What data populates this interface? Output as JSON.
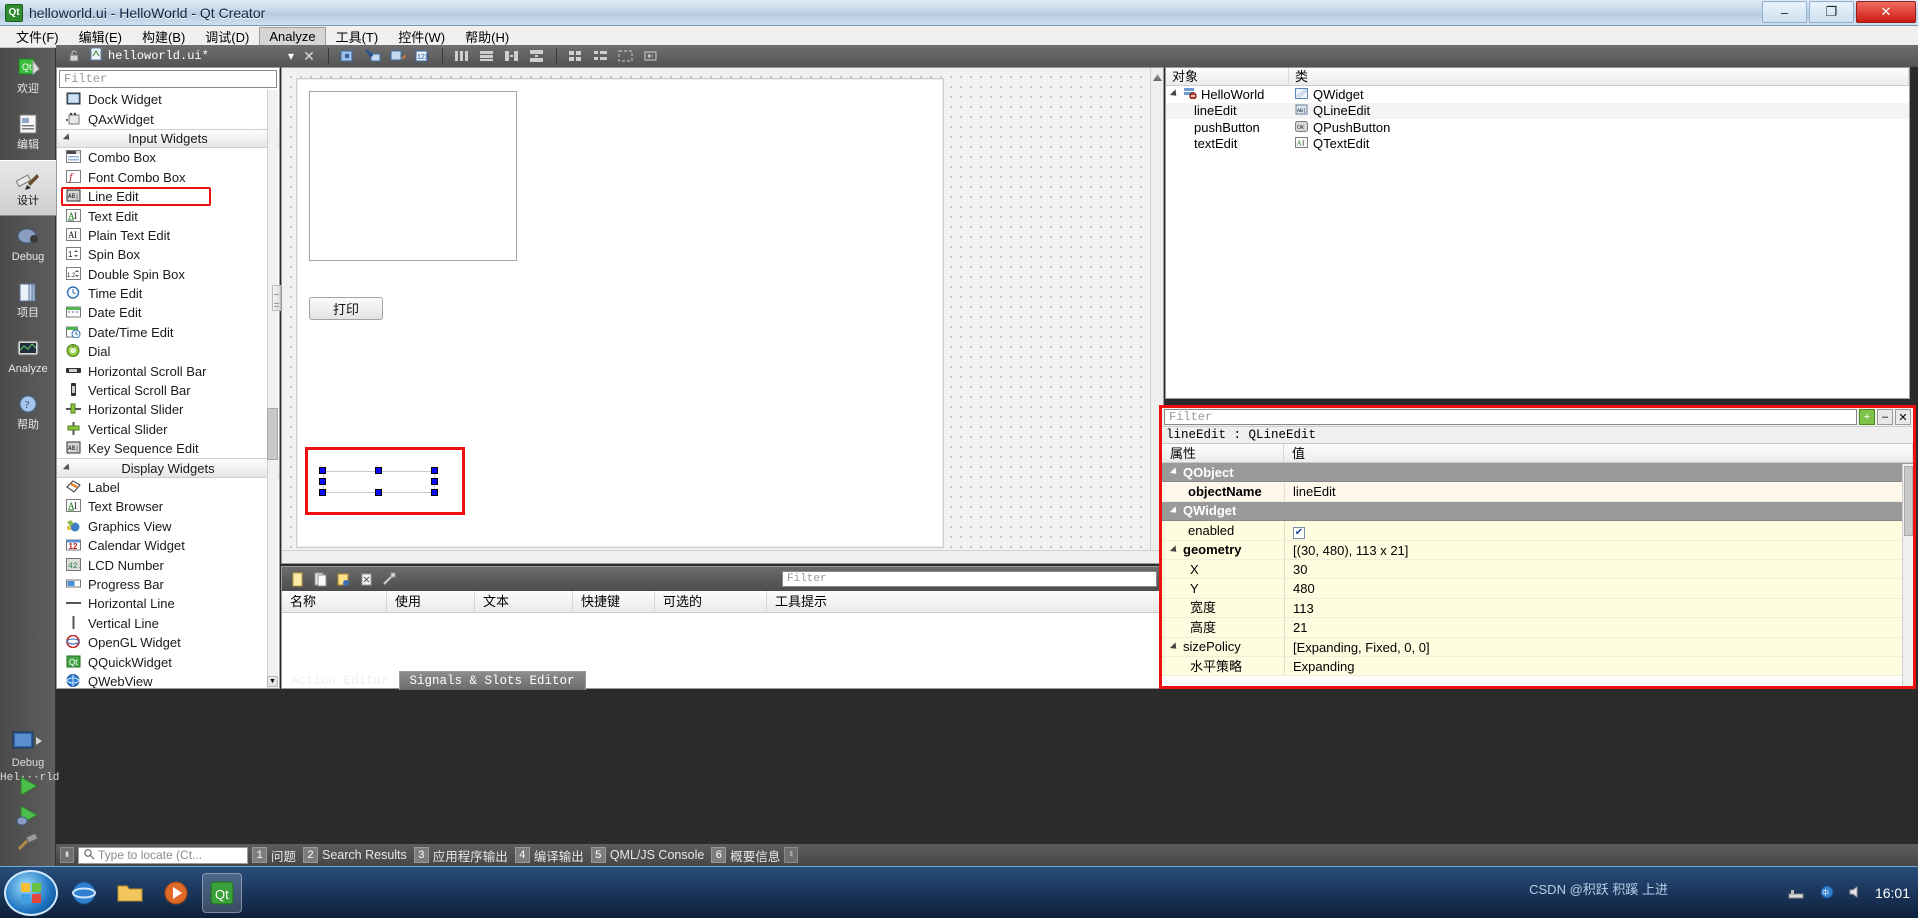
{
  "window": {
    "title": "helloworld.ui - HelloWorld - Qt Creator",
    "app_icon": "qt-logo-icon",
    "minimize": "–",
    "maximize": "❐",
    "close": "✕"
  },
  "menubar": {
    "items": [
      {
        "label": "文件(F)",
        "active": false
      },
      {
        "label": "编辑(E)",
        "active": false
      },
      {
        "label": "构建(B)",
        "active": false
      },
      {
        "label": "调试(D)",
        "active": false
      },
      {
        "label": "Analyze",
        "active": true
      },
      {
        "label": "工具(T)",
        "active": false
      },
      {
        "label": "控件(W)",
        "active": false
      },
      {
        "label": "帮助(H)",
        "active": false
      }
    ]
  },
  "modebar": {
    "items": [
      {
        "label": "欢迎",
        "icon": "qt-welcome-icon",
        "selected": false
      },
      {
        "label": "编辑",
        "icon": "edit-document-icon",
        "selected": false
      },
      {
        "label": "设计",
        "icon": "design-brush-icon",
        "selected": true
      },
      {
        "label": "Debug",
        "icon": "debug-bug-icon",
        "selected": false
      },
      {
        "label": "项目",
        "icon": "projects-folder-icon",
        "selected": false
      },
      {
        "label": "Analyze",
        "icon": "analyze-scope-icon",
        "selected": false
      },
      {
        "label": "帮助",
        "icon": "help-question-icon",
        "selected": false
      }
    ],
    "kit_label": "Hel···rld",
    "debug_label": "Debug",
    "run_icon": "run-play-icon",
    "debug_run_icon": "debug-play-icon",
    "build_icon": "build-hammer-icon"
  },
  "editor_toolbar": {
    "lock_icon": "unlocked-icon",
    "file_icon": "ui-file-icon",
    "file_name": "helloworld.ui*",
    "dropdown_icon": "chevron-down-icon",
    "close_icon": "close-icon",
    "tools": [
      {
        "icon": "edit-widgets-icon",
        "name": "edit-widgets-tool"
      },
      {
        "icon": "edit-signals-slots-icon",
        "name": "edit-signals-slots-tool"
      },
      {
        "icon": "edit-buddies-icon",
        "name": "edit-buddies-tool"
      },
      {
        "icon": "edit-tab-order-icon",
        "name": "edit-tab-order-tool"
      },
      {
        "icon": "layout-horizontal-icon",
        "name": "layout-horizontally-tool"
      },
      {
        "icon": "layout-vertical-icon",
        "name": "layout-vertically-tool"
      },
      {
        "icon": "layout-splitter-h-icon",
        "name": "layout-split-horizontal-tool"
      },
      {
        "icon": "layout-splitter-v-icon",
        "name": "layout-split-vertical-tool"
      },
      {
        "icon": "layout-grid-icon",
        "name": "layout-grid-tool"
      },
      {
        "icon": "layout-form-icon",
        "name": "layout-form-tool"
      },
      {
        "icon": "layout-break-icon",
        "name": "break-layout-tool"
      },
      {
        "icon": "layout-adjust-icon",
        "name": "adjust-size-tool"
      }
    ]
  },
  "widgetbox": {
    "filter_placeholder": "Filter",
    "items": [
      {
        "label": "Dock Widget",
        "icon": "dock-widget-icon",
        "type": "item"
      },
      {
        "label": "QAxWidget",
        "icon": "qax-widget-icon",
        "type": "item"
      },
      {
        "label": "Input Widgets",
        "icon": "collapse-triangle-icon",
        "type": "group"
      },
      {
        "label": "Combo Box",
        "icon": "combo-box-icon",
        "type": "item"
      },
      {
        "label": "Font Combo Box",
        "icon": "font-combo-box-icon",
        "type": "item"
      },
      {
        "label": "Line Edit",
        "icon": "line-edit-icon",
        "type": "item",
        "highlighted": true
      },
      {
        "label": "Text Edit",
        "icon": "text-edit-icon",
        "type": "item"
      },
      {
        "label": "Plain Text Edit",
        "icon": "plain-text-edit-icon",
        "type": "item"
      },
      {
        "label": "Spin Box",
        "icon": "spin-box-icon",
        "type": "item"
      },
      {
        "label": "Double Spin Box",
        "icon": "double-spin-box-icon",
        "type": "item"
      },
      {
        "label": "Time Edit",
        "icon": "time-edit-icon",
        "type": "item"
      },
      {
        "label": "Date Edit",
        "icon": "date-edit-icon",
        "type": "item"
      },
      {
        "label": "Date/Time Edit",
        "icon": "date-time-edit-icon",
        "type": "item"
      },
      {
        "label": "Dial",
        "icon": "dial-icon",
        "type": "item"
      },
      {
        "label": "Horizontal Scroll Bar",
        "icon": "horizontal-scroll-bar-icon",
        "type": "item"
      },
      {
        "label": "Vertical Scroll Bar",
        "icon": "vertical-scroll-bar-icon",
        "type": "item"
      },
      {
        "label": "Horizontal Slider",
        "icon": "horizontal-slider-icon",
        "type": "item"
      },
      {
        "label": "Vertical Slider",
        "icon": "vertical-slider-icon",
        "type": "item"
      },
      {
        "label": "Key Sequence Edit",
        "icon": "key-sequence-edit-icon",
        "type": "item"
      },
      {
        "label": "Display Widgets",
        "icon": "collapse-triangle-icon",
        "type": "group"
      },
      {
        "label": "Label",
        "icon": "label-icon",
        "type": "item"
      },
      {
        "label": "Text Browser",
        "icon": "text-browser-icon",
        "type": "item"
      },
      {
        "label": "Graphics View",
        "icon": "graphics-view-icon",
        "type": "item"
      },
      {
        "label": "Calendar Widget",
        "icon": "calendar-widget-icon",
        "type": "item"
      },
      {
        "label": "LCD Number",
        "icon": "lcd-number-icon",
        "type": "item"
      },
      {
        "label": "Progress Bar",
        "icon": "progress-bar-icon",
        "type": "item"
      },
      {
        "label": "Horizontal Line",
        "icon": "horizontal-line-icon",
        "type": "item"
      },
      {
        "label": "Vertical Line",
        "icon": "vertical-line-icon",
        "type": "item"
      },
      {
        "label": "OpenGL Widget",
        "icon": "opengl-widget-icon",
        "type": "item"
      },
      {
        "label": "QQuickWidget",
        "icon": "qquick-widget-icon",
        "type": "item"
      },
      {
        "label": "QWebView",
        "icon": "qweb-view-icon",
        "type": "item"
      }
    ]
  },
  "canvas": {
    "form_name": "HelloWorld",
    "widgets": {
      "text_edit_placeholder": "",
      "push_button_label": "打印",
      "line_edit_value": ""
    }
  },
  "action_editor": {
    "toolbar_icons": [
      {
        "name": "new-action-icon"
      },
      {
        "name": "copy-action-icon"
      },
      {
        "name": "edit-action-icon"
      },
      {
        "name": "delete-action-icon"
      },
      {
        "name": "configure-action-icon"
      }
    ],
    "filter_placeholder": "Filter",
    "columns": [
      "名称",
      "使用",
      "文本",
      "快捷键",
      "可选的",
      "工具提示"
    ],
    "rows": [],
    "tabs": [
      {
        "label": "Action Editor",
        "selected": false
      },
      {
        "label": "Signals & Slots Editor",
        "selected": true
      }
    ]
  },
  "object_inspector": {
    "columns": [
      "对象",
      "类"
    ],
    "rows": [
      {
        "object": "HelloWorld",
        "class": "QWidget",
        "icon": "widget-icon",
        "class_icon": "qwidget-icon",
        "indent": 0,
        "expander": true,
        "selected": false
      },
      {
        "object": "lineEdit",
        "class": "QLineEdit",
        "icon": "",
        "class_icon": "qlineedit-icon",
        "indent": 1,
        "expander": false,
        "selected": true
      },
      {
        "object": "pushButton",
        "class": "QPushButton",
        "icon": "",
        "class_icon": "qpushbutton-icon",
        "indent": 1,
        "expander": false,
        "selected": false
      },
      {
        "object": "textEdit",
        "class": "QTextEdit",
        "icon": "",
        "class_icon": "qtextedit-icon",
        "indent": 1,
        "expander": false,
        "selected": false
      }
    ]
  },
  "property_editor": {
    "filter_placeholder": "Filter",
    "add_icon": "plus-icon",
    "config_icon": "minus-icon",
    "close_icon": "close-icon",
    "subject": "lineEdit : QLineEdit",
    "columns": [
      "属性",
      "值"
    ],
    "rows": [
      {
        "key": "QObject",
        "value": "",
        "kind": "group"
      },
      {
        "key": "objectName",
        "value": "lineEdit",
        "kind": "prop",
        "bold": true,
        "shade": "w1"
      },
      {
        "key": "QWidget",
        "value": "",
        "kind": "group"
      },
      {
        "key": "enabled",
        "value": "",
        "kind": "checkbox",
        "checked": true,
        "shade": "y1"
      },
      {
        "key": "geometry",
        "value": "[(30, 480), 113 x 21]",
        "kind": "expandable",
        "bold": true,
        "shade": "y1"
      },
      {
        "key": "X",
        "value": "30",
        "kind": "sub",
        "shade": "y1"
      },
      {
        "key": "Y",
        "value": "480",
        "kind": "sub",
        "shade": "y1"
      },
      {
        "key": "宽度",
        "value": "113",
        "kind": "sub",
        "shade": "y1"
      },
      {
        "key": "高度",
        "value": "21",
        "kind": "sub",
        "shade": "y1"
      },
      {
        "key": "sizePolicy",
        "value": "[Expanding, Fixed, 0, 0]",
        "kind": "expandable",
        "shade": "y1"
      },
      {
        "key": "水平策略",
        "value": "Expanding",
        "kind": "sub",
        "shade": "y1"
      }
    ]
  },
  "statusbar": {
    "locator_icon": "search-icon",
    "locator_placeholder": "Type to locate (Ct...",
    "panes": [
      {
        "num": "1",
        "label": "问题"
      },
      {
        "num": "2",
        "label": "Search Results"
      },
      {
        "num": "3",
        "label": "应用程序输出"
      },
      {
        "num": "4",
        "label": "编译输出"
      },
      {
        "num": "5",
        "label": "QML/JS Console"
      },
      {
        "num": "6",
        "label": "概要信息"
      }
    ]
  },
  "taskbar": {
    "start_icon": "windows-start-icon",
    "items": [
      {
        "icon": "ie-browser-icon",
        "active": false
      },
      {
        "icon": "folder-explorer-icon",
        "active": false
      },
      {
        "icon": "media-player-icon",
        "active": false
      },
      {
        "icon": "qt-creator-icon",
        "active": true
      }
    ],
    "tray_icons": [
      "network-icon",
      "volume-icon",
      "input-method-icon"
    ],
    "watermark": "CSDN @积跃 积蹊 上进",
    "clock_time": "16:01",
    "clock_date": ""
  }
}
